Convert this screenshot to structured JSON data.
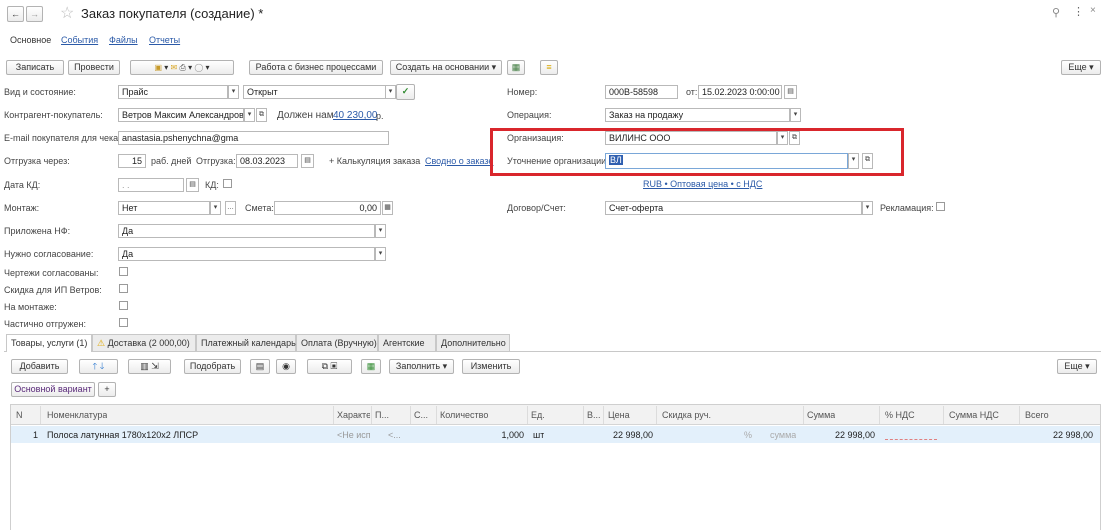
{
  "title": "Заказ покупателя (создание) *",
  "nav_tabs": [
    "Основное",
    "События",
    "Файлы",
    "Отчеты"
  ],
  "toolbar": {
    "save": "Записать",
    "post": "Провести",
    "business_processes": "Работа с бизнес процессами",
    "create_based": "Создать на основании",
    "more": "Еще"
  },
  "form": {
    "status_label": "Вид и состояние:",
    "kind": "Прайс",
    "state": "Открыт",
    "customer_label": "Контрагент-покупатель:",
    "customer": "Ветров Максим Александрович",
    "debt_label": "Должен нам",
    "debt_amount": "40 230,00",
    "debt_currency": "р.",
    "email_label": "E-mail покупателя для чека:",
    "email": "anastasia.pshenychna@gma",
    "shipment_label": "Отгрузка через:",
    "shipment_days": "15",
    "shipment_days_unit": "раб. дней",
    "shipment_date_label": "Отгрузка:",
    "shipment_date": "08.03.2023",
    "calc_label": "+ Калькуляция заказа",
    "summary_link": "Сводно о заказе",
    "kd_date_label": "Дата КД:",
    "kd_date": ". .",
    "kd_label": "КД:",
    "montage_label": "Монтаж:",
    "montage": "Нет",
    "estimate_label": "Смета:",
    "estimate": "0,00",
    "invoice_attached_label": "Приложена НФ:",
    "invoice_attached": "Да",
    "approval_needed_label": "Нужно согласование:",
    "approval_needed": "Да",
    "drawings_label": "Чертежи согласованы:",
    "discount_label": "Скидка для ИП Ветров:",
    "on_montage_label": "На монтаже:",
    "partially_shipped_label": "Частично отгружен:",
    "number_label": "Номер:",
    "number": "000В-58598",
    "from_label": "от:",
    "doc_date": "15.02.2023  0:00:00",
    "operation_label": "Операция:",
    "operation": "Заказ на продажу",
    "org_label": "Организация:",
    "org": "ВИЛИНС ООО",
    "org_refine_label": "Уточнение организации:",
    "org_refine": "ВЛ",
    "price_link": "RUB • Оптовая цена • с НДС",
    "contract_label": "Договор/Счет:",
    "contract": "Счет-оферта",
    "complaint_label": "Рекламация:"
  },
  "lower_tabs": [
    "Товары, услуги (1)",
    "Доставка (2 000,00)",
    "Платежный календарь",
    "Оплата (Вручную)",
    "Агентские",
    "Дополнительно"
  ],
  "goods_toolbar": {
    "add": "Добавить",
    "pick": "Подобрать",
    "fill": "Заполнить",
    "change": "Изменить",
    "more": "Еще"
  },
  "variant": "Основной вариант",
  "variant_add": "+",
  "table": {
    "headers": [
      "N",
      "Номенклатура",
      "Характе...",
      "П...",
      "С...",
      "Количество",
      "Ед.",
      "В...",
      "Цена",
      "Скидка руч.",
      "Сумма",
      "% НДС",
      "Сумма НДС",
      "Всего"
    ],
    "rows": [
      {
        "n": "1",
        "name": "Полоса латунная 1780х120х2 ЛПСР",
        "char": "<Не исп...",
        "p": "<...",
        "qty": "1,000",
        "unit": "шт",
        "price": "22 998,00",
        "discount_pct": "%",
        "discount_sum": "сумма",
        "sum": "22 998,00",
        "total": "22 998,00"
      }
    ]
  },
  "colors": {
    "highlight": "#d9262c",
    "link": "#2b5aa8",
    "row_selected": "#e3f0fb"
  }
}
